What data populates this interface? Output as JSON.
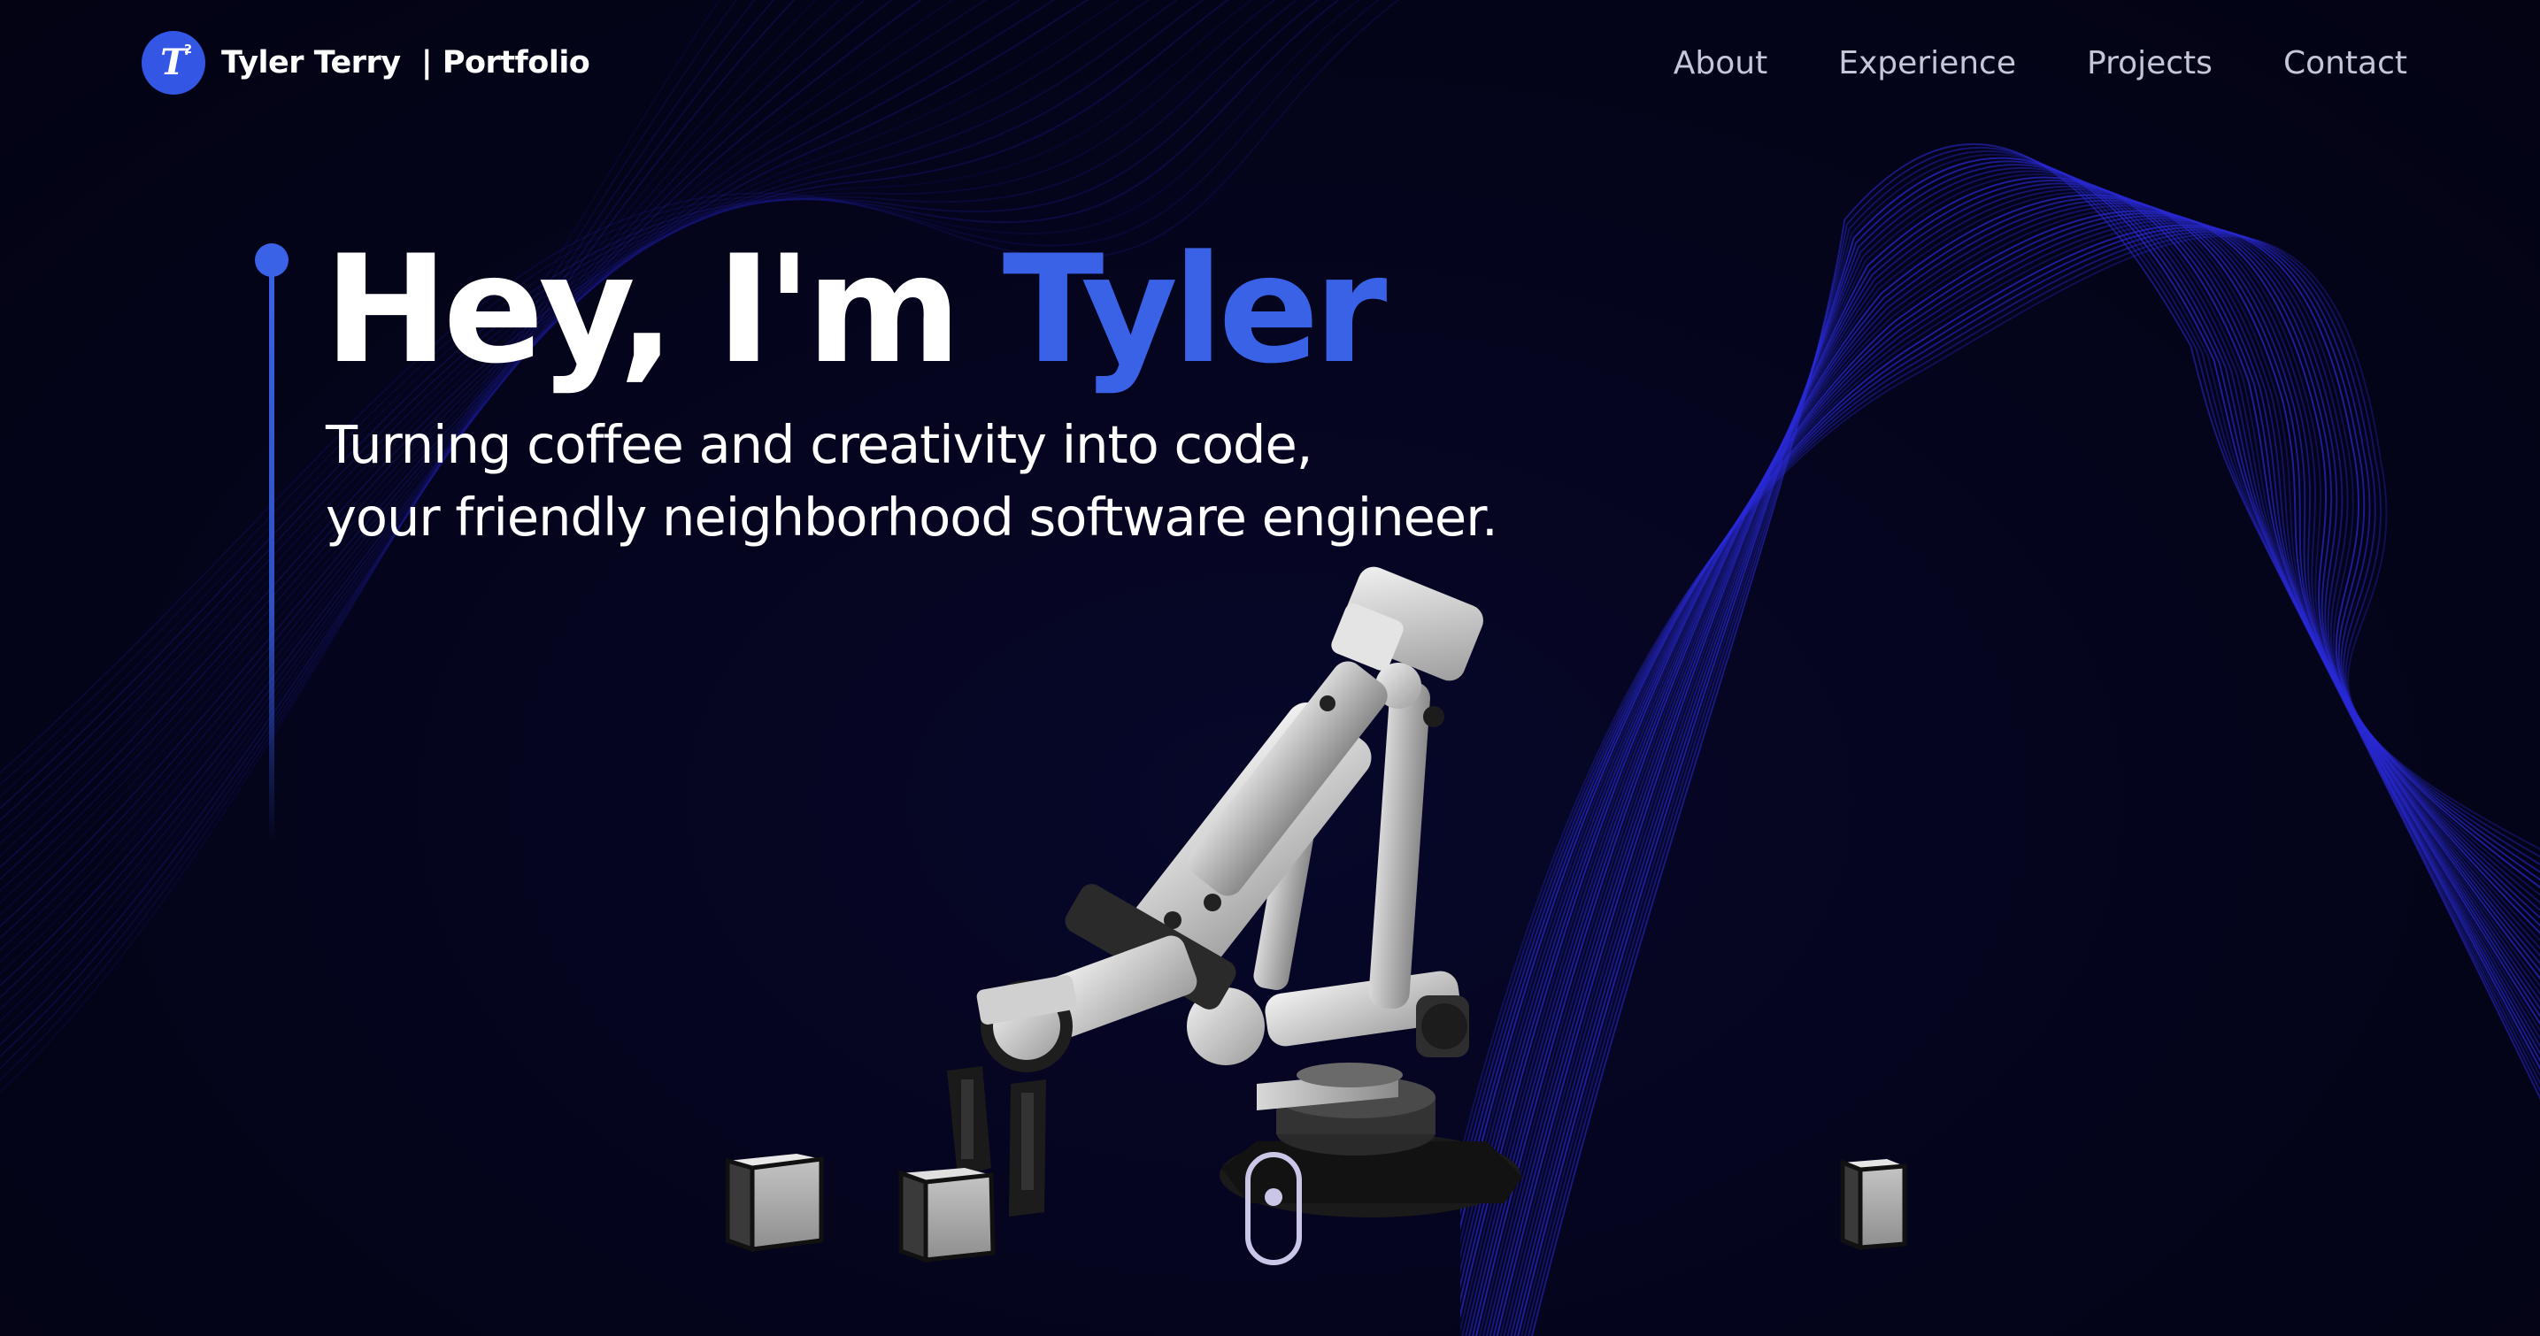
{
  "nav": {
    "brand": "Tyler Terry  | Portfolio",
    "logo_letter": "T",
    "logo_superscript": "2",
    "links": [
      "About",
      "Experience",
      "Projects",
      "Contact"
    ]
  },
  "hero": {
    "title_prefix": "Hey, I'm ",
    "title_name": "Tyler",
    "subtitle_line1": "Turning coffee and creativity into code,",
    "subtitle_line2": "your friendly neighborhood software engineer."
  },
  "colors": {
    "background": "#04041a",
    "accent": "#3a62e6",
    "wave": "#2a2ad6",
    "text": "#ffffff",
    "nav_text": "#c5c6d8"
  },
  "icons": {
    "logo": "t-squared-logo-icon",
    "scroll": "mouse-scroll-icon"
  }
}
